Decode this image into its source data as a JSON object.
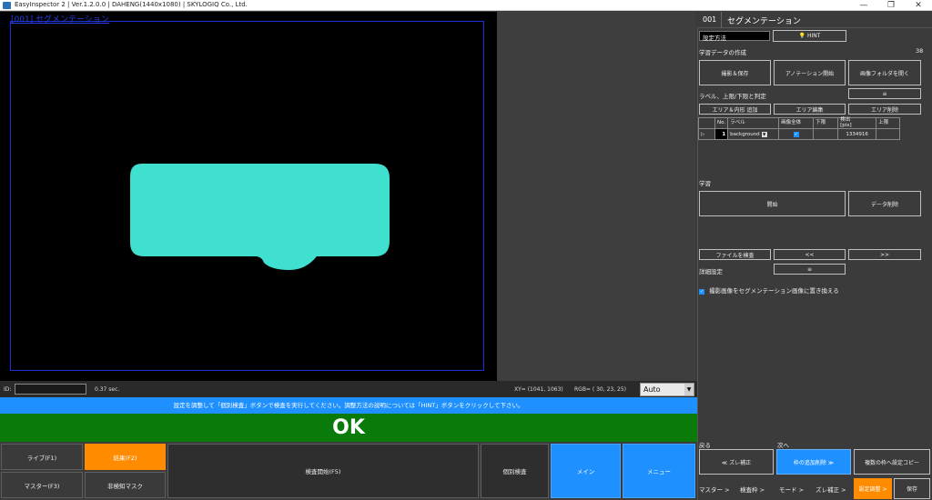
{
  "window": {
    "title": "EasyInspector 2 | Ver.1.2.0.0 | DAHENG(1440x1080) | SKYLOGIQ Co., Ltd.",
    "minimize": "—",
    "maximize": "❐",
    "close": "✕"
  },
  "image_view": {
    "label": "[001] セグメンテーション",
    "fill_color": "#40e0d0"
  },
  "status": {
    "id_label": "ID:",
    "time": "0.37 sec.",
    "xy": "XY= (1041, 1063)",
    "rgb": "RGB= ( 30,  23,  25)",
    "mode": "Auto"
  },
  "info_message": "設定を調整して「個別検査」ボタンで検査を実行してください。調整方法の説明については「HINT」ボタンをクリックして下さい。",
  "result": "OK",
  "bottom_buttons": {
    "live": "ライブ(F1)",
    "result": "結果(F2)",
    "master": "マスター(F3)",
    "nondetect_mask": "非検知マスク",
    "inspect_start": "検査開始(F5)",
    "individual": "個別検査",
    "main": "メイン",
    "menu": "メニュー"
  },
  "panel": {
    "number": "001",
    "title": "セグメンテーション",
    "method_label": "設定方法",
    "hint": "HINT",
    "training_data": "学習データの作成",
    "count": "38",
    "capture_save": "撮影＆保存",
    "annotation_start": "アノテーション開始",
    "open_folder": "画像フォルダを開く",
    "label_section": "ラベル、上限/下限と判定",
    "menu_glyph": "≡",
    "area_add": "エリア＆内形 追加",
    "area_edit": "エリア編集",
    "area_delete": "エリア削除",
    "table_headers": [
      "No.",
      "ラベル",
      "画像全体",
      "下限",
      "検出\n[pix]",
      "上限"
    ],
    "row": {
      "no": "1",
      "label": "background",
      "detected": "1334916"
    },
    "learn_section": "学習",
    "start": "開始",
    "data_delete": "データ削除",
    "inspect_file": "ファイルを検査",
    "prev": "<<",
    "next": ">>",
    "detail_settings": "詳細設定",
    "replace_option": "撮影画像をセグメンテーション画像に置き換える",
    "back_label": "戻る",
    "next_label": "次へ",
    "shift_correct": "≪ ズレ補正",
    "add_frame_delete": "枠の追加削除 ≫",
    "copy_settings": "複数の枠へ設定コピー",
    "nav": [
      "マスター >",
      "検査枠 >",
      "モード >",
      "ズレ補正 >"
    ],
    "settings_adjust": "設定調整 >",
    "save": "保存"
  }
}
